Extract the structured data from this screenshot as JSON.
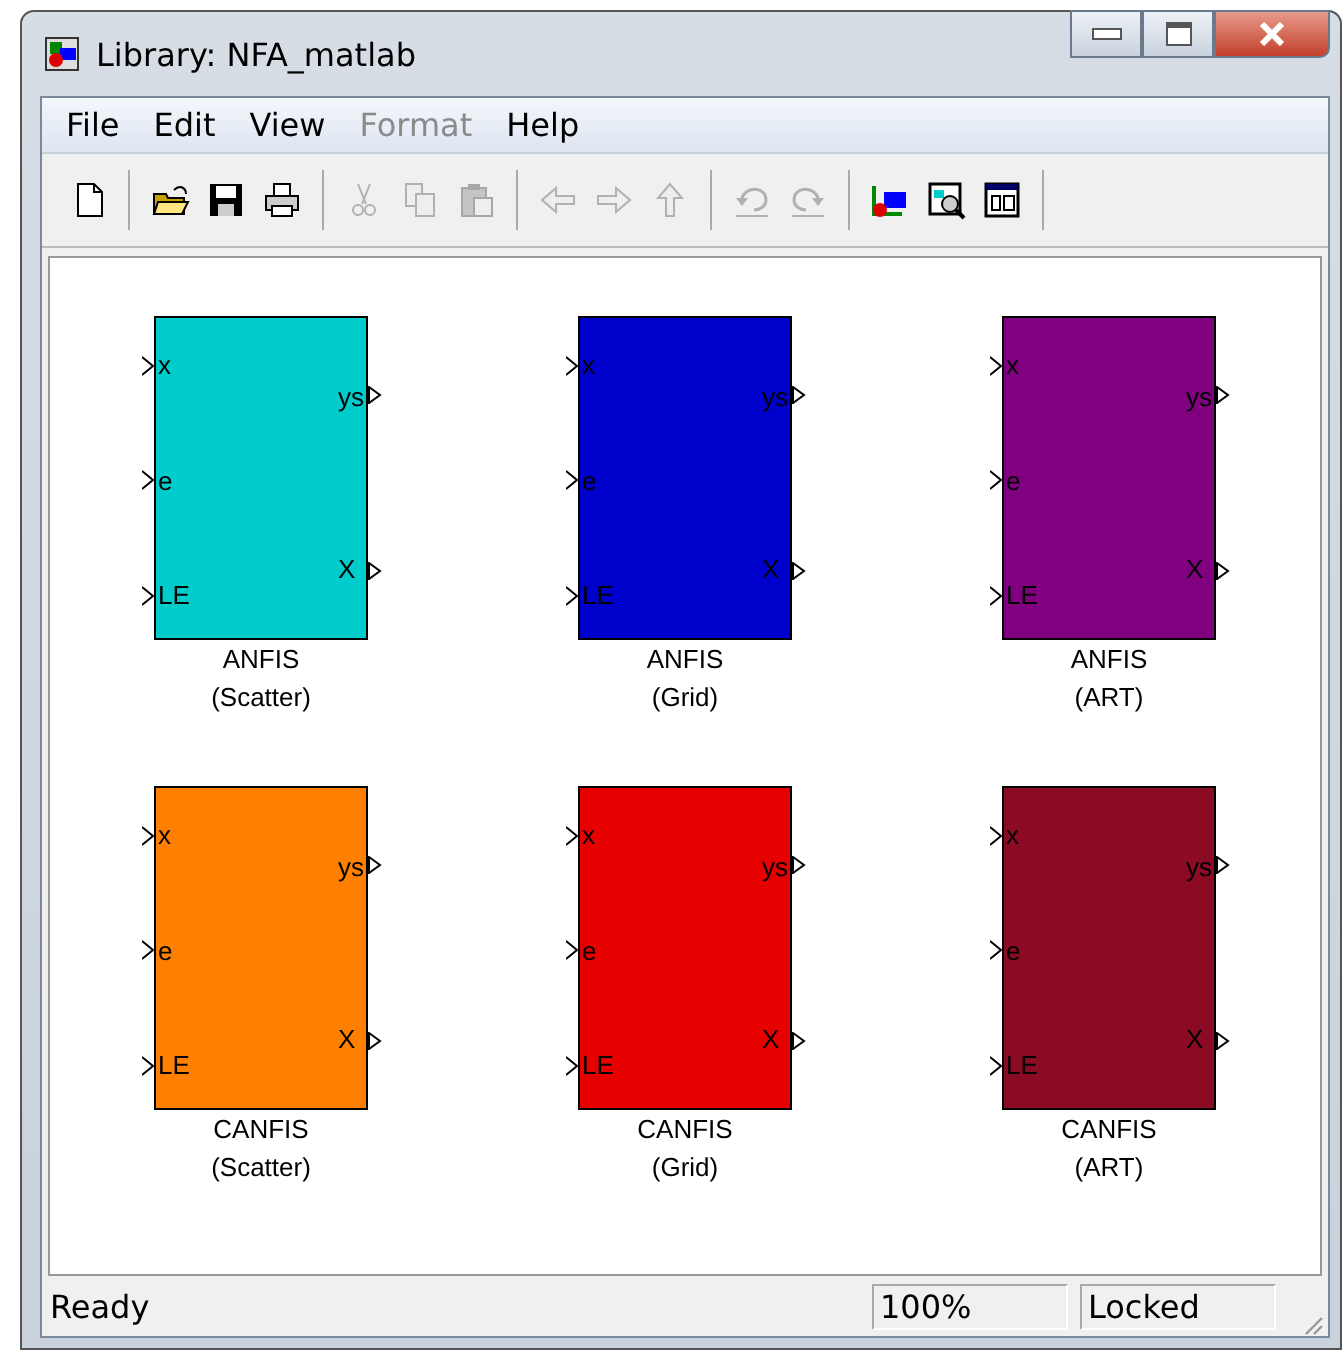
{
  "window": {
    "title": "Library: NFA_matlab"
  },
  "menu": [
    {
      "label": "File",
      "disabled": false
    },
    {
      "label": "Edit",
      "disabled": false
    },
    {
      "label": "View",
      "disabled": false
    },
    {
      "label": "Format",
      "disabled": true
    },
    {
      "label": "Help",
      "disabled": false
    }
  ],
  "toolbar": [
    {
      "kind": "new",
      "disabled": false
    },
    {
      "kind": "separator"
    },
    {
      "kind": "open",
      "disabled": false
    },
    {
      "kind": "save",
      "disabled": false
    },
    {
      "kind": "print",
      "disabled": false
    },
    {
      "kind": "separator"
    },
    {
      "kind": "cut",
      "disabled": true
    },
    {
      "kind": "copy",
      "disabled": true
    },
    {
      "kind": "paste",
      "disabled": true
    },
    {
      "kind": "separator"
    },
    {
      "kind": "back",
      "disabled": true
    },
    {
      "kind": "forward",
      "disabled": true
    },
    {
      "kind": "up",
      "disabled": true
    },
    {
      "kind": "separator"
    },
    {
      "kind": "undo",
      "disabled": true
    },
    {
      "kind": "redo",
      "disabled": true
    },
    {
      "kind": "separator"
    },
    {
      "kind": "library",
      "disabled": false
    },
    {
      "kind": "explorer",
      "disabled": false
    },
    {
      "kind": "debugger",
      "disabled": false
    },
    {
      "kind": "separator"
    }
  ],
  "blocks": [
    {
      "name": "ANFIS",
      "subtitle": "(Scatter)",
      "color": "#00cccc",
      "inputs": [
        "x",
        "e",
        "LE"
      ],
      "outputs": [
        "ys",
        "X"
      ]
    },
    {
      "name": "ANFIS",
      "subtitle": "(Grid)",
      "color": "#0000cc",
      "inputs": [
        "x",
        "e",
        "LE"
      ],
      "outputs": [
        "ys",
        "X"
      ]
    },
    {
      "name": "ANFIS",
      "subtitle": "(ART)",
      "color": "#800080",
      "inputs": [
        "x",
        "e",
        "LE"
      ],
      "outputs": [
        "ys",
        "X"
      ]
    },
    {
      "name": "CANFIS",
      "subtitle": "(Scatter)",
      "color": "#ff8000",
      "inputs": [
        "x",
        "e",
        "LE"
      ],
      "outputs": [
        "ys",
        "X"
      ]
    },
    {
      "name": "CANFIS",
      "subtitle": "(Grid)",
      "color": "#e60000",
      "inputs": [
        "x",
        "e",
        "LE"
      ],
      "outputs": [
        "ys",
        "X"
      ]
    },
    {
      "name": "CANFIS",
      "subtitle": "(ART)",
      "color": "#8b0a24",
      "inputs": [
        "x",
        "e",
        "LE"
      ],
      "outputs": [
        "ys",
        "X"
      ]
    }
  ],
  "status_bar": {
    "message": "Ready",
    "zoom": "100%",
    "mode": "Locked"
  }
}
